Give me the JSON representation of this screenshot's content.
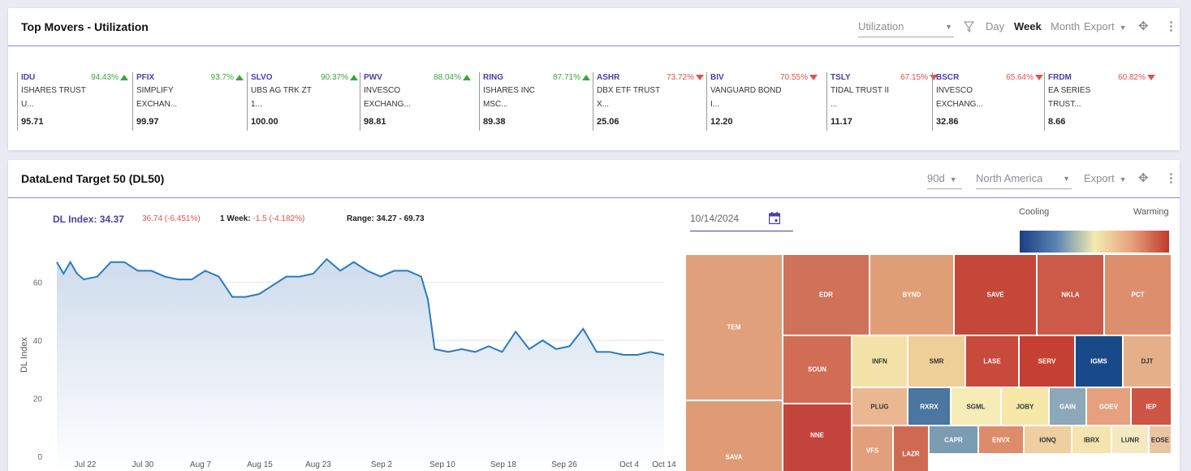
{
  "movers_panel": {
    "title": "Top Movers - Utilization",
    "metric_select": "Utilization",
    "ranges": [
      "Day",
      "Week",
      "Month"
    ],
    "active_range": "Week",
    "export_label": "Export",
    "items": [
      {
        "ticker": "IDU",
        "pct": "94.43%",
        "dir": "up",
        "name1": "ISHARES TRUST",
        "name2": "U...",
        "value": "95.71"
      },
      {
        "ticker": "PFIX",
        "pct": "93.7%",
        "dir": "up",
        "name1": "SIMPLIFY",
        "name2": "EXCHAN...",
        "value": "99.97"
      },
      {
        "ticker": "SLVO",
        "pct": "90.37%",
        "dir": "up",
        "name1": "UBS AG TRK ZT",
        "name2": "1...",
        "value": "100.00"
      },
      {
        "ticker": "PWV",
        "pct": "88.04%",
        "dir": "up",
        "name1": "INVESCO",
        "name2": "EXCHANG...",
        "value": "98.81"
      },
      {
        "ticker": "RING",
        "pct": "87.71%",
        "dir": "up",
        "name1": "ISHARES INC",
        "name2": "MSC...",
        "value": "89.38"
      },
      {
        "ticker": "ASHR",
        "pct": "73.72%",
        "dir": "down",
        "name1": "DBX ETF TRUST",
        "name2": "X...",
        "value": "25.06"
      },
      {
        "ticker": "BIV",
        "pct": "70.55%",
        "dir": "down",
        "name1": "VANGUARD BOND",
        "name2": "I...",
        "value": "12.20"
      },
      {
        "ticker": "TSLY",
        "pct": "67.15%",
        "dir": "down",
        "name1": "TIDAL TRUST II",
        "name2": "...",
        "value": "11.17"
      },
      {
        "ticker": "BSCR",
        "pct": "65.64%",
        "dir": "down",
        "name1": "INVESCO",
        "name2": "EXCHANG...",
        "value": "32.86"
      },
      {
        "ticker": "FRDM",
        "pct": "60.82%",
        "dir": "down",
        "name1": "EA SERIES",
        "name2": "TRUST...",
        "value": "8.66"
      }
    ]
  },
  "dl50_panel": {
    "title": "DataLend Target 50 (DL50)",
    "period_select": "90d",
    "region_select": "North America",
    "export_label": "Export",
    "dl_index_label": "DL Index:",
    "dl_index_value": "34.37",
    "change": "36.74 (-6.451%)",
    "week_label": "1 Week:",
    "week_value": "-1.5 (-4.182%)",
    "range_label": "Range:",
    "range_value": "34.27 - 69.73",
    "date": "10/14/2024",
    "legend_low": "Cooling",
    "legend_high": "Warming"
  },
  "chart_data": {
    "type": "area",
    "ylabel": "DL Index",
    "xlabel": "",
    "ylim": [
      0,
      70
    ],
    "yticks": [
      0,
      20,
      40,
      60
    ],
    "xticks": [
      "Jul 22",
      "Jul 30",
      "Aug 7",
      "Aug 15",
      "Aug 23",
      "Sep 2",
      "Sep 10",
      "Sep 18",
      "Sep 26",
      "Oct 4",
      "Oct 14"
    ],
    "grid": true,
    "x": [
      "Jul 16",
      "Jul 17",
      "Jul 18",
      "Jul 19",
      "Jul 20",
      "Jul 22",
      "Jul 24",
      "Jul 26",
      "Jul 28",
      "Jul 30",
      "Aug 1",
      "Aug 3",
      "Aug 5",
      "Aug 7",
      "Aug 9",
      "Aug 11",
      "Aug 13",
      "Aug 15",
      "Aug 17",
      "Aug 19",
      "Aug 21",
      "Aug 23",
      "Aug 25",
      "Aug 27",
      "Aug 29",
      "Aug 31",
      "Sep 2",
      "Sep 4",
      "Sep 6",
      "Sep 8",
      "Sep 9",
      "Sep 10",
      "Sep 12",
      "Sep 14",
      "Sep 16",
      "Sep 18",
      "Sep 20",
      "Sep 22",
      "Sep 24",
      "Sep 26",
      "Sep 28",
      "Sep 30",
      "Oct 2",
      "Oct 4",
      "Oct 6",
      "Oct 8",
      "Oct 10",
      "Oct 12",
      "Oct 14"
    ],
    "series": [
      {
        "values": [
          67,
          63,
          67,
          63,
          61,
          62,
          67,
          67,
          64,
          64,
          62,
          61,
          61,
          64,
          62,
          55,
          55,
          56,
          59,
          62,
          62,
          63,
          68,
          64,
          67,
          64,
          62,
          64,
          64,
          62,
          54,
          37,
          36,
          37,
          36,
          38,
          36,
          43,
          37,
          40,
          37,
          38,
          44,
          36,
          36,
          35,
          35,
          36,
          35
        ]
      }
    ]
  },
  "treemap": [
    {
      "label": "TEM",
      "color": "#e0a07c"
    },
    {
      "label": "EDR",
      "color": "#d0715a"
    },
    {
      "label": "BYND",
      "color": "#e09e77"
    },
    {
      "label": "SAVE",
      "color": "#c5473a"
    },
    {
      "label": "NKLA",
      "color": "#cc5a48"
    },
    {
      "label": "PCT",
      "color": "#dd8f6d"
    },
    {
      "label": "SOUN",
      "color": "#d16c55"
    },
    {
      "label": "INFN",
      "color": "#f3e3a8"
    },
    {
      "label": "SMR",
      "color": "#efcf98"
    },
    {
      "label": "LASE",
      "color": "#c84a3c"
    },
    {
      "label": "SERV",
      "color": "#c54032"
    },
    {
      "label": "IGMS",
      "color": "#184a8a"
    },
    {
      "label": "DJT",
      "color": "#e5b089"
    },
    {
      "label": "SAVA",
      "color": "#df9a76"
    },
    {
      "label": "NNE",
      "color": "#c3443a"
    },
    {
      "label": "PLUG",
      "color": "#e9b892"
    },
    {
      "label": "RXRX",
      "color": "#4a76a0"
    },
    {
      "label": "SGML",
      "color": "#f6ecb8"
    },
    {
      "label": "JOBY",
      "color": "#f5e8a8"
    },
    {
      "label": "GAIN",
      "color": "#8da8b8"
    },
    {
      "label": "GOEV",
      "color": "#e5a07e"
    },
    {
      "label": "IEP",
      "color": "#cc5545"
    },
    {
      "label": "VFS",
      "color": "#e29f7b"
    },
    {
      "label": "LAZR",
      "color": "#cf6a52"
    },
    {
      "label": "CAPR",
      "color": "#7b9cb1"
    },
    {
      "label": "ENVX",
      "color": "#dd8c6b"
    },
    {
      "label": "IONQ",
      "color": "#efcfa0"
    },
    {
      "label": "IBRX",
      "color": "#f3e4b0"
    },
    {
      "label": "LUNR",
      "color": "#f4e9c0"
    },
    {
      "label": "EOSE",
      "color": "#e9c6a2"
    }
  ]
}
